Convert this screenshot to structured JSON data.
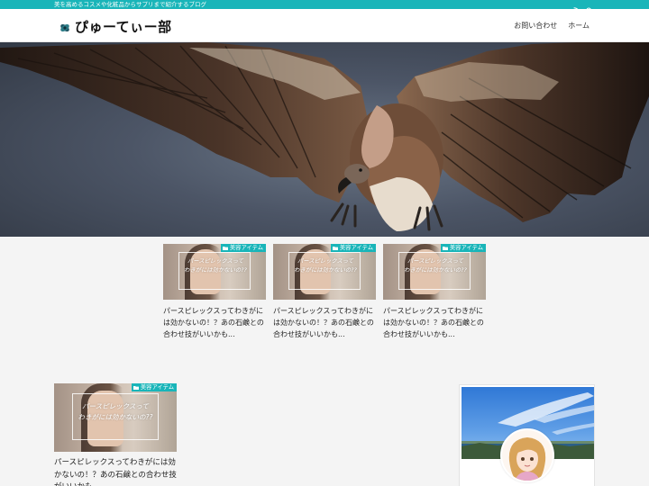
{
  "site": {
    "tagline": "美を高めるコスメや化粧品からサプリまで紹介するブログ",
    "title": "ぴゅーてぃー部",
    "logo_icon": "leaf-logo-icon",
    "accent_color": "#19b5b9"
  },
  "topbar_icons": [
    "rss-icon",
    "search-icon"
  ],
  "nav": {
    "items": [
      {
        "label": "お問い合わせ"
      },
      {
        "label": "ホーム"
      }
    ]
  },
  "hero": {
    "image": "vulture-wings-spread-photo"
  },
  "featured": [
    {
      "category": "美容アイテム",
      "thumb_text_1": "パースピレックスって",
      "thumb_text_2": "わきがには効かないの??",
      "title": "パースピレックスってわきがには効かないの！？あの石鹸との合わせ技がいいかも..."
    },
    {
      "category": "美容アイテム",
      "thumb_text_1": "パースピレックスって",
      "thumb_text_2": "わきがには効かないの??",
      "title": "パースピレックスってわきがには効かないの！？あの石鹸との合わせ技がいいかも..."
    },
    {
      "category": "美容アイテム",
      "thumb_text_1": "パースピレックスって",
      "thumb_text_2": "わきがには効かないの??",
      "title": "パースピレックスってわきがには効かないの！？あの石鹸との合わせ技がいいかも..."
    }
  ],
  "main_posts": [
    {
      "category": "美容アイテム",
      "thumb_text_1": "パースピレックスって",
      "thumb_text_2": "わきがには効かないの??",
      "title": "パースピレックスってわきがには効かないの！？あの石鹸との合わせ技がいいかも..."
    }
  ],
  "sidebar": {
    "profile_image": "sea-sky-photo",
    "avatar": "anime-girl-avatar"
  }
}
